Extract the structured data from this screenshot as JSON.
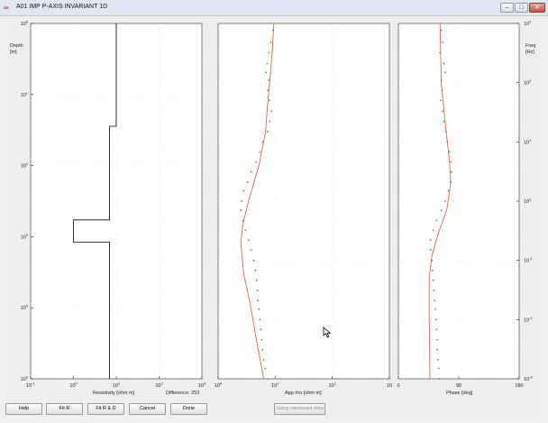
{
  "window": {
    "title": "A01 IMP P-AXIS INVARIANT 1D",
    "app_icon": "matlab-icon",
    "controls": [
      "minimize-icon",
      "maximize-icon",
      "close-icon"
    ]
  },
  "panels": {
    "resistivity": {
      "ylabel_line1": "Depth",
      "ylabel_line2": "[m]",
      "xlabel": "Resistivity [ohm m]",
      "difference_label": "Difference: 253",
      "x_ticks": [
        {
          "base": "10",
          "exp": "-1"
        },
        {
          "base": "10",
          "exp": "0"
        },
        {
          "base": "10",
          "exp": "1"
        },
        {
          "base": "10",
          "exp": "2"
        },
        {
          "base": "10",
          "exp": "3"
        }
      ],
      "y_ticks": [
        {
          "base": "10",
          "exp": "0"
        },
        {
          "base": "10",
          "exp": "1"
        },
        {
          "base": "10",
          "exp": "2"
        },
        {
          "base": "10",
          "exp": "3"
        },
        {
          "base": "10",
          "exp": "4"
        },
        {
          "base": "10",
          "exp": "5"
        }
      ]
    },
    "apprho": {
      "xlabel": "App rho [ohm m]",
      "x_ticks": [
        {
          "base": "10",
          "exp": "0"
        },
        {
          "base": "10",
          "exp": "1"
        },
        {
          "base": "10",
          "exp": "2"
        }
      ]
    },
    "phase": {
      "xlabel": "Phase [deg]",
      "ylabel_line1": "Freq",
      "ylabel_line2": "[Hz]",
      "x_ticks": [
        "0",
        "90",
        "180"
      ],
      "y_ticks": [
        {
          "base": "10",
          "exp": "3"
        },
        {
          "base": "10",
          "exp": "2"
        },
        {
          "base": "10",
          "exp": "1"
        },
        {
          "base": "10",
          "exp": "0"
        },
        {
          "base": "10",
          "exp": "-1"
        },
        {
          "base": "10",
          "exp": "-2"
        },
        {
          "base": "10",
          "exp": "-3"
        }
      ]
    }
  },
  "chart_data": [
    {
      "type": "line",
      "xlabel": "Resistivity [ohm m]",
      "ylabel": "Depth [m]",
      "xscale": "log",
      "yscale": "log",
      "xlim": [
        0.1,
        1000
      ],
      "ylim": [
        1,
        100000
      ],
      "grid": true,
      "series": [
        {
          "color": "#000000",
          "points": [
            [
              10,
              1
            ],
            [
              10,
              28
            ],
            [
              7,
              28
            ],
            [
              7,
              580
            ],
            [
              1,
              580
            ],
            [
              1,
              1200
            ],
            [
              7,
              1200
            ],
            [
              7,
              100000
            ]
          ]
        }
      ]
    },
    {
      "type": "scatter",
      "xlabel": "App rho [ohm m]",
      "xscale": "log",
      "xlim": [
        1,
        1000
      ],
      "yaxis": "frequency",
      "yscale": "log",
      "ylim": [
        1000,
        0.001
      ],
      "grid": true,
      "series": [
        {
          "color": "#e2533a",
          "style": "line",
          "points": [
            [
              9.5,
              1000
            ],
            [
              8.8,
              300
            ],
            [
              8,
              100
            ],
            [
              7.3,
              40
            ],
            [
              6.8,
              15
            ],
            [
              5.2,
              4
            ],
            [
              3.4,
              1
            ],
            [
              2.7,
              0.4
            ],
            [
              2.5,
              0.2
            ],
            [
              2.8,
              0.06
            ],
            [
              3.6,
              0.02
            ],
            [
              4.6,
              0.005
            ],
            [
              5.5,
              0.002
            ],
            [
              6.3,
              0.001
            ]
          ]
        },
        {
          "color": "#2e9e4e",
          "style": "dots",
          "points": [
            [
              9.2,
              770
            ],
            [
              8.4,
              480
            ],
            [
              7.8,
              320
            ],
            [
              7.2,
              210
            ],
            [
              6.9,
              150
            ],
            [
              7.7,
              110
            ],
            [
              7.4,
              75
            ],
            [
              7.9,
              50
            ],
            [
              8.6,
              33
            ],
            [
              8.0,
              22
            ],
            [
              7.3,
              15
            ],
            [
              6.1,
              10
            ],
            [
              5.4,
              6.8
            ],
            [
              4.6,
              4.6
            ],
            [
              3.8,
              3.1
            ],
            [
              3.3,
              2.1
            ],
            [
              2.8,
              1.5
            ],
            [
              2.6,
              1.0
            ],
            [
              2.5,
              0.7
            ],
            [
              2.7,
              0.47
            ],
            [
              3.0,
              0.32
            ],
            [
              3.4,
              0.22
            ],
            [
              3.8,
              0.15
            ],
            [
              4.2,
              0.1
            ],
            [
              4.5,
              0.068
            ],
            [
              4.7,
              0.046
            ],
            [
              4.9,
              0.031
            ],
            [
              5.0,
              0.021
            ],
            [
              5.2,
              0.015
            ],
            [
              5.4,
              0.01
            ],
            [
              5.6,
              0.0068
            ],
            [
              5.8,
              0.0046
            ],
            [
              6.0,
              0.0031
            ],
            [
              6.3,
              0.0021
            ],
            [
              6.7,
              0.0015
            ],
            [
              7.2,
              0.001
            ]
          ]
        }
      ]
    },
    {
      "type": "scatter",
      "xlabel": "Phase [deg]",
      "xlim": [
        0,
        180
      ],
      "ylabel": "Freq [Hz]",
      "yscale": "log",
      "ylim": [
        1000,
        0.001
      ],
      "grid": true,
      "series": [
        {
          "color": "#e2533a",
          "style": "line",
          "points": [
            [
              62,
              1000
            ],
            [
              64,
              100
            ],
            [
              70,
              20
            ],
            [
              76,
              5
            ],
            [
              78,
              2
            ],
            [
              72,
              0.7
            ],
            [
              60,
              0.3
            ],
            [
              50,
              0.12
            ],
            [
              46,
              0.05
            ],
            [
              46,
              0.01
            ],
            [
              47,
              0.001
            ]
          ]
        },
        {
          "color": "#2e9e4e",
          "style": "dots",
          "points": [
            [
              64,
              770
            ],
            [
              66,
              480
            ],
            [
              62,
              320
            ],
            [
              68,
              210
            ],
            [
              70,
              150
            ],
            [
              64,
              110
            ],
            [
              65,
              75
            ],
            [
              63,
              50
            ],
            [
              66,
              33
            ],
            [
              68,
              22
            ],
            [
              71,
              15
            ],
            [
              73,
              10
            ],
            [
              76,
              6.8
            ],
            [
              78,
              4.6
            ],
            [
              79,
              3.1
            ],
            [
              78,
              2.1
            ],
            [
              75,
              1.5
            ],
            [
              70,
              1.0
            ],
            [
              64,
              0.7
            ],
            [
              57,
              0.47
            ],
            [
              52,
              0.32
            ],
            [
              48,
              0.22
            ],
            [
              48,
              0.15
            ],
            [
              50,
              0.1
            ],
            [
              51,
              0.068
            ],
            [
              52,
              0.046
            ],
            [
              53,
              0.031
            ],
            [
              54,
              0.021
            ],
            [
              55,
              0.015
            ],
            [
              56,
              0.01
            ],
            [
              57,
              0.0068
            ],
            [
              58,
              0.0046
            ],
            [
              58,
              0.0031
            ],
            [
              59,
              0.0021
            ],
            [
              60,
              0.0015
            ],
            [
              61,
              0.001
            ]
          ]
        }
      ]
    }
  ],
  "buttons": {
    "help": "Help",
    "fit_r": "Fit R",
    "fit_r_d": "Fit R & D",
    "cancel": "Cancel",
    "done": "Done",
    "using_measured": "Using measured data"
  }
}
